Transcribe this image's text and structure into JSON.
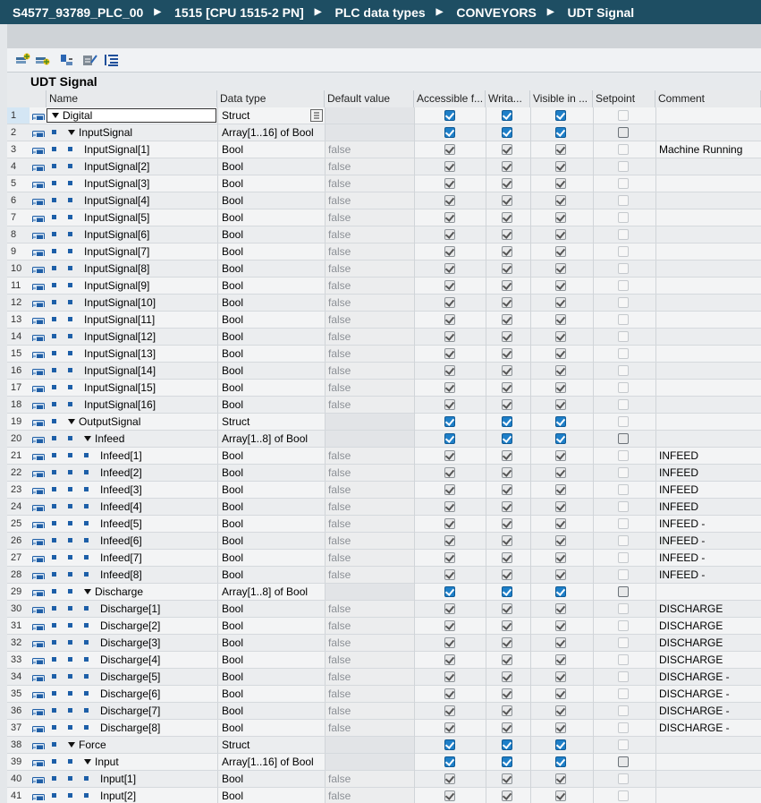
{
  "breadcrumb": [
    "S4577_93789_PLC_00",
    "1515 [CPU 1515-2 PN]",
    "PLC data types",
    "CONVEYORS",
    "UDT Signal"
  ],
  "title": "UDT Signal",
  "toolbar_icons": [
    "insert-row-icon",
    "add-row-icon",
    "expand-icon",
    "collapse-icon",
    "settings-list-icon"
  ],
  "headers": {
    "name": "Name",
    "data_type": "Data type",
    "default_value": "Default value",
    "accessible": "Accessible f...",
    "writable": "Writa...",
    "visible": "Visible in ...",
    "setpoint": "Setpoint",
    "comment": "Comment"
  },
  "rows": [
    {
      "n": "1",
      "name": "Digital",
      "indent": 0,
      "expand": true,
      "dtype": "Struct",
      "def": "",
      "kind": "struct",
      "comment": ""
    },
    {
      "n": "2",
      "name": "InputSignal",
      "indent": 1,
      "expand": true,
      "dtype": "Array[1..16] of Bool",
      "def": "",
      "kind": "array",
      "comment": ""
    },
    {
      "n": "3",
      "name": "InputSignal[1]",
      "indent": 2,
      "expand": false,
      "dtype": "Bool",
      "def": "false",
      "kind": "elem",
      "comment": "Machine Running"
    },
    {
      "n": "4",
      "name": "InputSignal[2]",
      "indent": 2,
      "expand": false,
      "dtype": "Bool",
      "def": "false",
      "kind": "elem",
      "comment": ""
    },
    {
      "n": "5",
      "name": "InputSignal[3]",
      "indent": 2,
      "expand": false,
      "dtype": "Bool",
      "def": "false",
      "kind": "elem",
      "comment": ""
    },
    {
      "n": "6",
      "name": "InputSignal[4]",
      "indent": 2,
      "expand": false,
      "dtype": "Bool",
      "def": "false",
      "kind": "elem",
      "comment": ""
    },
    {
      "n": "7",
      "name": "InputSignal[5]",
      "indent": 2,
      "expand": false,
      "dtype": "Bool",
      "def": "false",
      "kind": "elem",
      "comment": ""
    },
    {
      "n": "8",
      "name": "InputSignal[6]",
      "indent": 2,
      "expand": false,
      "dtype": "Bool",
      "def": "false",
      "kind": "elem",
      "comment": ""
    },
    {
      "n": "9",
      "name": "InputSignal[7]",
      "indent": 2,
      "expand": false,
      "dtype": "Bool",
      "def": "false",
      "kind": "elem",
      "comment": ""
    },
    {
      "n": "10",
      "name": "InputSignal[8]",
      "indent": 2,
      "expand": false,
      "dtype": "Bool",
      "def": "false",
      "kind": "elem",
      "comment": ""
    },
    {
      "n": "11",
      "name": "InputSignal[9]",
      "indent": 2,
      "expand": false,
      "dtype": "Bool",
      "def": "false",
      "kind": "elem",
      "comment": ""
    },
    {
      "n": "12",
      "name": "InputSignal[10]",
      "indent": 2,
      "expand": false,
      "dtype": "Bool",
      "def": "false",
      "kind": "elem",
      "comment": ""
    },
    {
      "n": "13",
      "name": "InputSignal[11]",
      "indent": 2,
      "expand": false,
      "dtype": "Bool",
      "def": "false",
      "kind": "elem",
      "comment": ""
    },
    {
      "n": "14",
      "name": "InputSignal[12]",
      "indent": 2,
      "expand": false,
      "dtype": "Bool",
      "def": "false",
      "kind": "elem",
      "comment": ""
    },
    {
      "n": "15",
      "name": "InputSignal[13]",
      "indent": 2,
      "expand": false,
      "dtype": "Bool",
      "def": "false",
      "kind": "elem",
      "comment": ""
    },
    {
      "n": "16",
      "name": "InputSignal[14]",
      "indent": 2,
      "expand": false,
      "dtype": "Bool",
      "def": "false",
      "kind": "elem",
      "comment": ""
    },
    {
      "n": "17",
      "name": "InputSignal[15]",
      "indent": 2,
      "expand": false,
      "dtype": "Bool",
      "def": "false",
      "kind": "elem",
      "comment": ""
    },
    {
      "n": "18",
      "name": "InputSignal[16]",
      "indent": 2,
      "expand": false,
      "dtype": "Bool",
      "def": "false",
      "kind": "elem",
      "comment": ""
    },
    {
      "n": "19",
      "name": "OutputSignal",
      "indent": 1,
      "expand": true,
      "dtype": "Struct",
      "def": "",
      "kind": "struct",
      "comment": ""
    },
    {
      "n": "20",
      "name": "Infeed",
      "indent": 2,
      "expand": true,
      "dtype": "Array[1..8] of Bool",
      "def": "",
      "kind": "array",
      "comment": ""
    },
    {
      "n": "21",
      "name": "Infeed[1]",
      "indent": 3,
      "expand": false,
      "dtype": "Bool",
      "def": "false",
      "kind": "elem",
      "comment": "INFEED"
    },
    {
      "n": "22",
      "name": "Infeed[2]",
      "indent": 3,
      "expand": false,
      "dtype": "Bool",
      "def": "false",
      "kind": "elem",
      "comment": "INFEED"
    },
    {
      "n": "23",
      "name": "Infeed[3]",
      "indent": 3,
      "expand": false,
      "dtype": "Bool",
      "def": "false",
      "kind": "elem",
      "comment": "INFEED"
    },
    {
      "n": "24",
      "name": "Infeed[4]",
      "indent": 3,
      "expand": false,
      "dtype": "Bool",
      "def": "false",
      "kind": "elem",
      "comment": "INFEED"
    },
    {
      "n": "25",
      "name": "Infeed[5]",
      "indent": 3,
      "expand": false,
      "dtype": "Bool",
      "def": "false",
      "kind": "elem",
      "comment": "INFEED -"
    },
    {
      "n": "26",
      "name": "Infeed[6]",
      "indent": 3,
      "expand": false,
      "dtype": "Bool",
      "def": "false",
      "kind": "elem",
      "comment": "INFEED -"
    },
    {
      "n": "27",
      "name": "Infeed[7]",
      "indent": 3,
      "expand": false,
      "dtype": "Bool",
      "def": "false",
      "kind": "elem",
      "comment": "INFEED -"
    },
    {
      "n": "28",
      "name": "Infeed[8]",
      "indent": 3,
      "expand": false,
      "dtype": "Bool",
      "def": "false",
      "kind": "elem",
      "comment": "INFEED -"
    },
    {
      "n": "29",
      "name": "Discharge",
      "indent": 2,
      "expand": true,
      "dtype": "Array[1..8] of Bool",
      "def": "",
      "kind": "array",
      "comment": ""
    },
    {
      "n": "30",
      "name": "Discharge[1]",
      "indent": 3,
      "expand": false,
      "dtype": "Bool",
      "def": "false",
      "kind": "elem",
      "comment": "DISCHARGE"
    },
    {
      "n": "31",
      "name": "Discharge[2]",
      "indent": 3,
      "expand": false,
      "dtype": "Bool",
      "def": "false",
      "kind": "elem",
      "comment": "DISCHARGE"
    },
    {
      "n": "32",
      "name": "Discharge[3]",
      "indent": 3,
      "expand": false,
      "dtype": "Bool",
      "def": "false",
      "kind": "elem",
      "comment": "DISCHARGE"
    },
    {
      "n": "33",
      "name": "Discharge[4]",
      "indent": 3,
      "expand": false,
      "dtype": "Bool",
      "def": "false",
      "kind": "elem",
      "comment": "DISCHARGE"
    },
    {
      "n": "34",
      "name": "Discharge[5]",
      "indent": 3,
      "expand": false,
      "dtype": "Bool",
      "def": "false",
      "kind": "elem",
      "comment": "DISCHARGE -"
    },
    {
      "n": "35",
      "name": "Discharge[6]",
      "indent": 3,
      "expand": false,
      "dtype": "Bool",
      "def": "false",
      "kind": "elem",
      "comment": "DISCHARGE -"
    },
    {
      "n": "36",
      "name": "Discharge[7]",
      "indent": 3,
      "expand": false,
      "dtype": "Bool",
      "def": "false",
      "kind": "elem",
      "comment": "DISCHARGE -"
    },
    {
      "n": "37",
      "name": "Discharge[8]",
      "indent": 3,
      "expand": false,
      "dtype": "Bool",
      "def": "false",
      "kind": "elem",
      "comment": "DISCHARGE -"
    },
    {
      "n": "38",
      "name": "Force",
      "indent": 1,
      "expand": true,
      "dtype": "Struct",
      "def": "",
      "kind": "struct",
      "comment": ""
    },
    {
      "n": "39",
      "name": "Input",
      "indent": 2,
      "expand": true,
      "dtype": "Array[1..16] of Bool",
      "def": "",
      "kind": "array",
      "comment": ""
    },
    {
      "n": "40",
      "name": "Input[1]",
      "indent": 3,
      "expand": false,
      "dtype": "Bool",
      "def": "false",
      "kind": "elem",
      "comment": ""
    },
    {
      "n": "41",
      "name": "Input[2]",
      "indent": 3,
      "expand": false,
      "dtype": "Bool",
      "def": "false",
      "kind": "elem",
      "comment": ""
    }
  ],
  "colors": {
    "breadcrumb_bg": "#1e4e63",
    "checkbox_blue": "#1e7fc8",
    "row_bg": "#f3f4f5"
  }
}
